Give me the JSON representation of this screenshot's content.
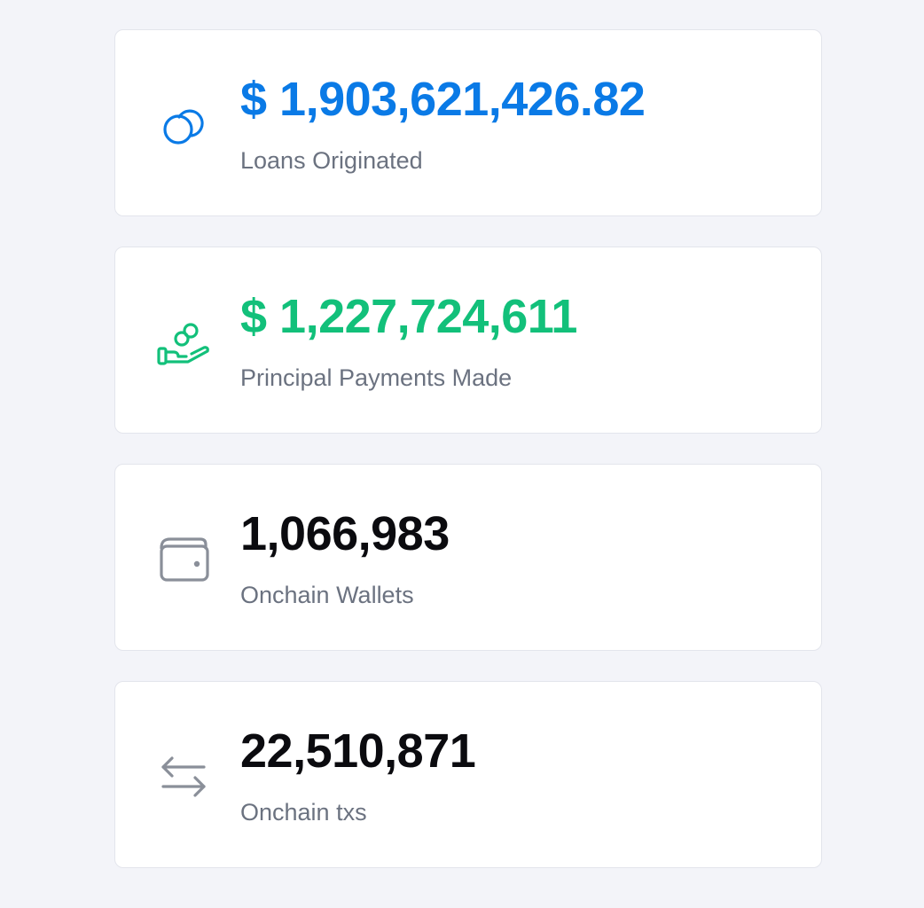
{
  "colors": {
    "blue": "#0a7ae6",
    "green": "#12c07a",
    "dark": "#0b0b0f",
    "gray_icon": "#8a8f99",
    "label": "#6b7280"
  },
  "stats": [
    {
      "icon": "coins-icon",
      "value": "$ 1,903,621,426.82",
      "label": "Loans Originated"
    },
    {
      "icon": "hand-coins-icon",
      "value": "$ 1,227,724,611",
      "label": "Principal Payments Made"
    },
    {
      "icon": "wallet-icon",
      "value": "1,066,983",
      "label": "Onchain Wallets"
    },
    {
      "icon": "transfer-arrows-icon",
      "value": "22,510,871",
      "label": "Onchain txs"
    }
  ]
}
